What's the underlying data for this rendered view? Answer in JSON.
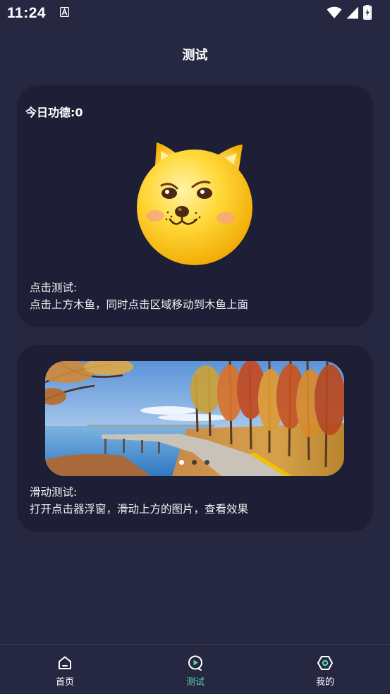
{
  "status_bar": {
    "time": "11:24",
    "icons": [
      "text-a-icon",
      "wifi-icon",
      "signal-icon",
      "battery-charging-icon"
    ]
  },
  "page": {
    "title": "测试"
  },
  "tap_card": {
    "merit_label": "今日功德:0",
    "image_icon": "doge-wooden-fish-icon",
    "instruction_title": "点击测试:",
    "instruction_text": "点击上方木鱼，同时点击区域移动到木鱼上面"
  },
  "swipe_card": {
    "banner_image": "autumn-lake-boardwalk-photo",
    "banner_pages": 3,
    "banner_active_index": 0,
    "instruction_title": "滑动测试:",
    "instruction_text": "打开点击器浮窗，滑动上方的图片，查看效果"
  },
  "bottom_nav": {
    "items": [
      {
        "label": "首页",
        "icon": "home-icon",
        "active": false
      },
      {
        "label": "测试",
        "icon": "play-circle-icon",
        "active": true
      },
      {
        "label": "我的",
        "icon": "hexagon-gear-icon",
        "active": false
      }
    ],
    "active_color": "#5ad6a7"
  },
  "colors": {
    "background": "#262741",
    "card": "#1e1e36",
    "text": "#ffffff"
  }
}
